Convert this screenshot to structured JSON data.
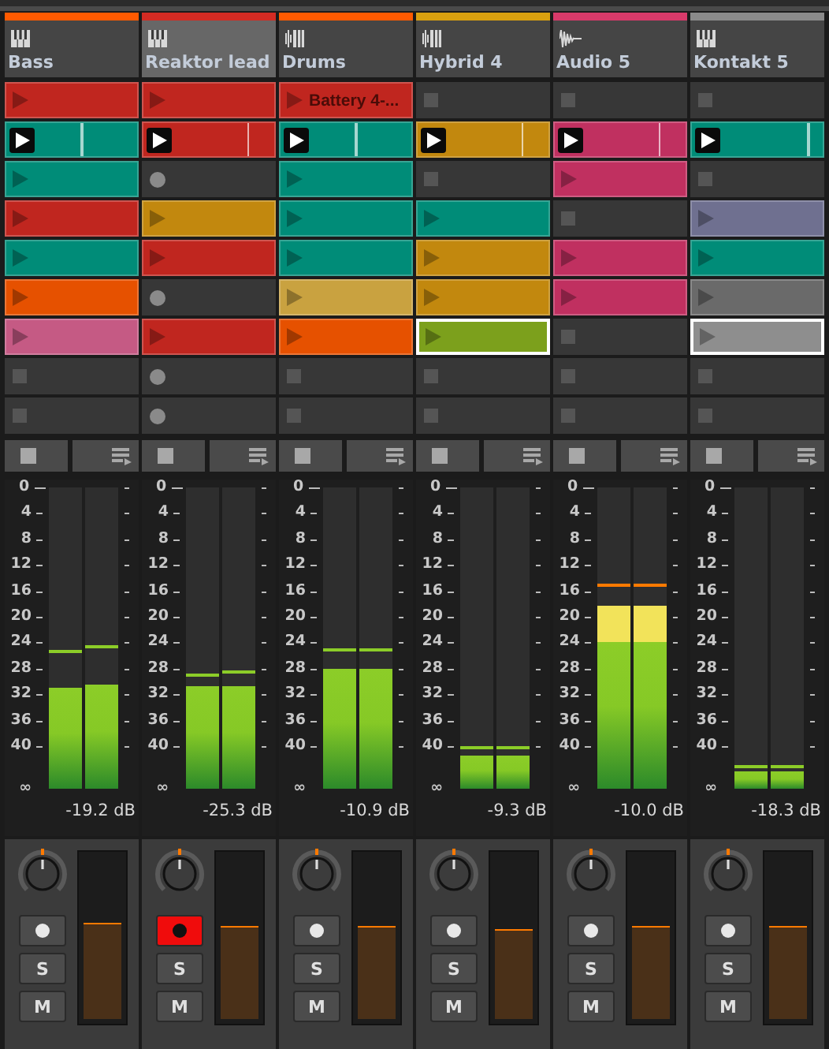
{
  "tracks": [
    {
      "name": "Bass",
      "color": "#ff5a00",
      "selected": false,
      "kind": "instrument",
      "armed": false,
      "solo": "S",
      "mute": "M",
      "clips": [
        {
          "kind": "clip",
          "color": "#c0261f",
          "selected": false
        },
        {
          "kind": "playing",
          "color": "#008c78",
          "selected": false,
          "level": 0.57
        },
        {
          "kind": "clip",
          "color": "#008c78",
          "selected": false
        },
        {
          "kind": "clip",
          "color": "#c0261f",
          "selected": false
        },
        {
          "kind": "clip",
          "color": "#008c78",
          "selected": false
        },
        {
          "kind": "clip",
          "color": "#e65100",
          "selected": false
        },
        {
          "kind": "clip",
          "color": "#c55a84",
          "selected": false
        },
        {
          "kind": "empty"
        },
        {
          "kind": "empty"
        }
      ],
      "scale": [
        "0",
        "4",
        "8",
        "12",
        "16",
        "20",
        "24",
        "28",
        "32",
        "36",
        "40",
        "∞"
      ],
      "meter": [
        {
          "level": 0.335,
          "peak": {
            "level": 0.45
          }
        },
        {
          "level": 0.345,
          "peak": {
            "level": 0.466
          }
        }
      ],
      "reading": "-19.2 dB",
      "fader": {
        "level": 0.56
      }
    },
    {
      "name": "Reaktor lead",
      "color": "#d42b23",
      "selected": true,
      "kind": "instrument",
      "armed": true,
      "solo": "S",
      "mute": "M",
      "clips": [
        {
          "kind": "clip",
          "color": "#c0261f",
          "selected": false
        },
        {
          "kind": "playing",
          "color": "#c0261f",
          "selected": false,
          "level": 0.79
        },
        {
          "kind": "empty"
        },
        {
          "kind": "clip",
          "color": "#c2880e",
          "selected": false
        },
        {
          "kind": "clip",
          "color": "#c0261f",
          "selected": false
        },
        {
          "kind": "empty"
        },
        {
          "kind": "clip",
          "color": "#c0261f",
          "selected": false
        },
        {
          "kind": "empty"
        },
        {
          "kind": "empty"
        }
      ],
      "scale": [
        "0",
        "4",
        "8",
        "12",
        "16",
        "20",
        "24",
        "28",
        "32",
        "36",
        "40",
        "∞"
      ],
      "meter": [
        {
          "level": 0.34,
          "peak": {
            "level": 0.37
          }
        },
        {
          "level": 0.34,
          "peak": {
            "level": 0.38
          }
        }
      ],
      "reading": "-25.3 dB",
      "fader": {
        "level": 0.54
      }
    },
    {
      "name": "Drums",
      "color": "#ff5a00",
      "selected": false,
      "kind": "drum",
      "armed": false,
      "solo": "S",
      "mute": "M",
      "clips": [
        {
          "kind": "clip",
          "color": "#c0261f",
          "selected": false,
          "label": "Battery 4-..."
        },
        {
          "kind": "playing",
          "color": "#008c78",
          "selected": false,
          "level": 0.57
        },
        {
          "kind": "clip",
          "color": "#008c78",
          "selected": false
        },
        {
          "kind": "clip",
          "color": "#008c78",
          "selected": false
        },
        {
          "kind": "clip",
          "color": "#008c78",
          "selected": false
        },
        {
          "kind": "clip",
          "color": "#c9a240",
          "selected": false
        },
        {
          "kind": "clip",
          "color": "#e65100",
          "selected": false
        },
        {
          "kind": "empty"
        },
        {
          "kind": "empty"
        }
      ],
      "scale": [
        "0",
        "4",
        "8",
        "12",
        "16",
        "20",
        "24",
        "28",
        "32",
        "36",
        "40",
        "∞"
      ],
      "meter": [
        {
          "level": 0.4,
          "peak": {
            "level": 0.455
          }
        },
        {
          "level": 0.4,
          "peak": {
            "level": 0.455
          }
        }
      ],
      "reading": "-10.9 dB",
      "fader": {
        "level": 0.54
      }
    },
    {
      "name": "Hybrid 4",
      "color": "#d9a00f",
      "selected": false,
      "kind": "drum",
      "armed": false,
      "solo": "S",
      "mute": "M",
      "clips": [
        {
          "kind": "empty"
        },
        {
          "kind": "playing",
          "color": "#c2880e",
          "selected": false,
          "level": 0.79
        },
        {
          "kind": "empty"
        },
        {
          "kind": "clip",
          "color": "#008c78",
          "selected": false
        },
        {
          "kind": "clip",
          "color": "#c2880e",
          "selected": false
        },
        {
          "kind": "clip",
          "color": "#c2880e",
          "selected": false
        },
        {
          "kind": "clip",
          "color": "#7ca01c",
          "selected": true
        },
        {
          "kind": "empty"
        },
        {
          "kind": "empty"
        }
      ],
      "scale": [
        "0",
        "4",
        "8",
        "12",
        "16",
        "20",
        "24",
        "28",
        "32",
        "36",
        "40",
        "∞"
      ],
      "meter": [
        {
          "level": 0.11,
          "peak": {
            "level": 0.13
          }
        },
        {
          "level": 0.11,
          "peak": {
            "level": 0.13
          }
        }
      ],
      "reading": "-9.3 dB",
      "fader": {
        "level": 0.52
      }
    },
    {
      "name": "Audio 5",
      "color": "#d83a6a",
      "selected": false,
      "kind": "audio",
      "armed": false,
      "solo": "S",
      "mute": "M",
      "clips": [
        {
          "kind": "empty"
        },
        {
          "kind": "playing",
          "color": "#c03060",
          "selected": false,
          "level": 0.79
        },
        {
          "kind": "clip",
          "color": "#c03060",
          "selected": false
        },
        {
          "kind": "empty"
        },
        {
          "kind": "clip",
          "color": "#c03060",
          "selected": false
        },
        {
          "kind": "clip",
          "color": "#c03060",
          "selected": false
        },
        {
          "kind": "empty"
        },
        {
          "kind": "empty"
        },
        {
          "kind": "empty"
        }
      ],
      "scale": [
        "0",
        "4",
        "8",
        "12",
        "16",
        "20",
        "24",
        "28",
        "32",
        "36",
        "40",
        "∞"
      ],
      "meter": [
        {
          "level": 0.61,
          "peak": {
            "level": 0.67
          }
        },
        {
          "level": 0.61,
          "peak": {
            "level": 0.67
          }
        }
      ],
      "reading": "-10.0 dB",
      "fader": {
        "level": 0.54
      }
    },
    {
      "name": "Kontakt 5",
      "color": "#8a8a8a",
      "selected": false,
      "kind": "instrument",
      "armed": false,
      "solo": "S",
      "mute": "M",
      "clips": [
        {
          "kind": "empty"
        },
        {
          "kind": "playing",
          "color": "#008c78",
          "selected": false,
          "level": 0.88
        },
        {
          "kind": "empty"
        },
        {
          "kind": "clip",
          "color": "#6f7090",
          "selected": false
        },
        {
          "kind": "clip",
          "color": "#008c78",
          "selected": false
        },
        {
          "kind": "clip",
          "color": "#6a6a6a",
          "selected": false
        },
        {
          "kind": "clip",
          "color": "#8e8e8e",
          "selected": true
        },
        {
          "kind": "empty"
        },
        {
          "kind": "empty"
        }
      ],
      "scale": [
        "0",
        "4",
        "8",
        "12",
        "16",
        "20",
        "24",
        "28",
        "32",
        "36",
        "40",
        "∞"
      ],
      "meter": [
        {
          "level": 0.06,
          "peak": {
            "level": 0.07
          }
        },
        {
          "level": 0.06,
          "peak": {
            "level": 0.07
          }
        }
      ],
      "reading": "-18.3 dB",
      "fader": {
        "level": 0.54
      }
    }
  ]
}
